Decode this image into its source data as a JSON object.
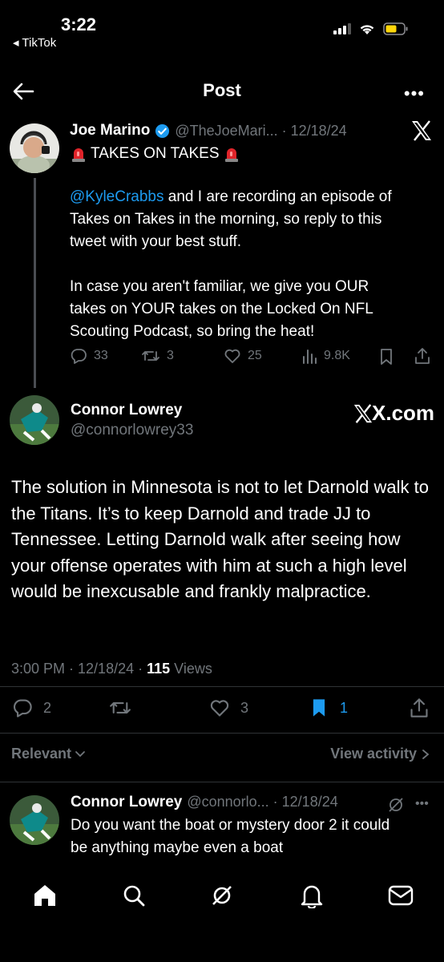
{
  "status_bar": {
    "time": "3:22",
    "back_app": "◂ TikTok"
  },
  "header": {
    "title": "Post",
    "more": "•••"
  },
  "quoted_tweet": {
    "author_name": "Joe Marino",
    "handle_date": "@TheJoeMari... · 12/18/24",
    "title_line": "TAKES ON TAKES",
    "mention": "@KyleCrabbs",
    "body_line1_rest": " and I are recording an episode of",
    "body_line2": "Takes on Takes in the morning, so reply to this",
    "body_line3": "tweet with your best stuff.",
    "body_line4": "In case you aren't familiar, we give you OUR",
    "body_line5": "takes on YOUR takes on the Locked On NFL",
    "body_line6": "Scouting Podcast, so bring the heat!",
    "replies": "33",
    "reposts": "3",
    "likes": "25",
    "views": "9.8K"
  },
  "main_post": {
    "author_name": "Connor Lowrey",
    "handle": "@connorlowrey33",
    "watermark": "X.com",
    "text": "The solution in Minnesota is not to let Darnold walk to the Titans. It’s to keep Darnold and trade JJ to Tennessee. Letting Darnold walk after seeing how your offense operates with him at such a high level would be inexcusable and frankly malpractice.",
    "meta_time": "3:00 PM · 12/18/24 · ",
    "meta_views_count": "115",
    "meta_views_label": " Views",
    "replies": "2",
    "likes": "3",
    "bookmarks": "1"
  },
  "replies_bar": {
    "sort": "Relevant",
    "activity": "View activity"
  },
  "reply": {
    "author_name": "Connor Lowrey",
    "handle_date": "@connorlo... · 12/18/24",
    "line1": "Do you want the boat or mystery door 2 it could",
    "line2": "be anything maybe even a boat"
  },
  "colors": {
    "accent": "#1d9bf0",
    "muted": "#71767b",
    "verified": "#1d9bf0",
    "battery": "#ffd60a"
  }
}
